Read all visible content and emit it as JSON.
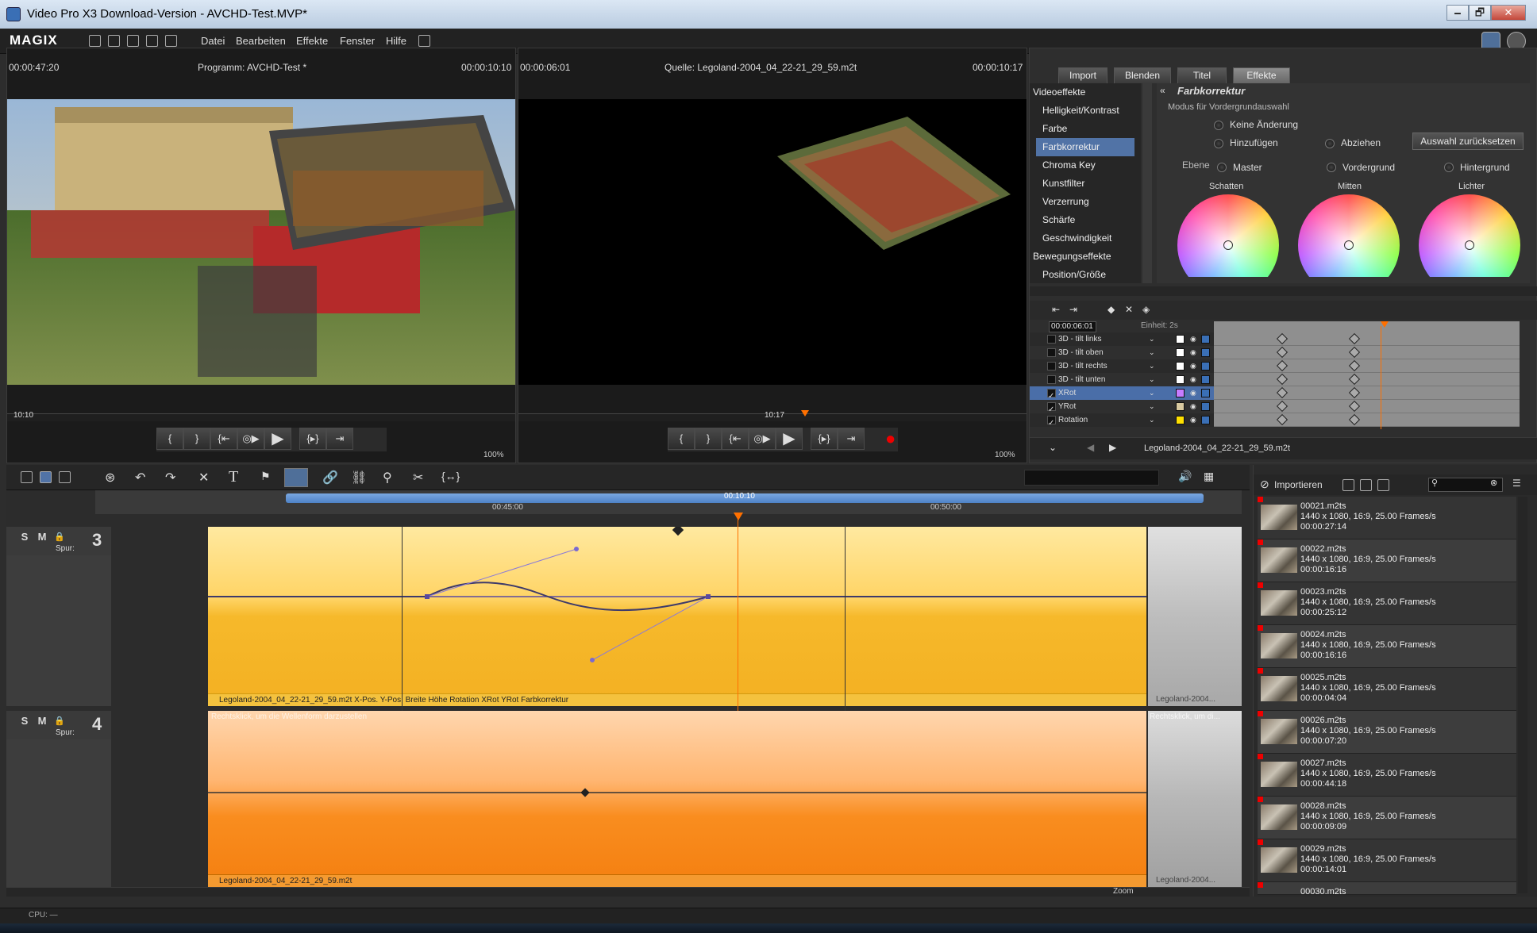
{
  "window": {
    "title": "Video Pro X3 Download-Version - AVCHD-Test.MVP*",
    "min": "🗕",
    "max": "🗗",
    "close": "✕"
  },
  "menu": {
    "logo": "MAGIX",
    "items": [
      "Datei",
      "Bearbeiten",
      "Effekte",
      "Fenster",
      "Hilfe"
    ]
  },
  "program_monitor": {
    "time_left": "00:00:47:20",
    "title": "Programm: AVCHD-Test *",
    "time_right": "00:00:10:10",
    "ruler_label": "10:10",
    "zoom": "100%"
  },
  "source_monitor": {
    "time_left": "00:00:06:01",
    "title": "Quelle: Legoland-2004_04_22-21_29_59.m2t",
    "time_right": "00:00:10:17",
    "ruler_label": "10:17",
    "zoom": "100%"
  },
  "transport": {
    "buttons": [
      "{",
      "}",
      "{⇤",
      "◎▶",
      "▶",
      "{▸}",
      "⇥"
    ],
    "record": "●"
  },
  "effects_panel": {
    "tabs": [
      "Import",
      "Blenden",
      "Titel",
      "Effekte"
    ],
    "active_tab": "Effekte",
    "categories": [
      {
        "label": "Videoeffekte",
        "items": [
          "Helligkeit/Kontrast",
          "Farbe",
          "Farbkorrektur",
          "Chroma Key",
          "Kunstfilter",
          "Verzerrung",
          "Schärfe",
          "Geschwindigkeit"
        ]
      },
      {
        "label": "Bewegungseffekte",
        "items": [
          "Position/Größe"
        ]
      }
    ],
    "selected_item": "Farbkorrektur",
    "heading": "Farbkorrektur",
    "mode_label": "Modus für Vordergrundauswahl",
    "radios": {
      "keine": "Keine Änderung",
      "hinzu": "Hinzufügen",
      "abziehen": "Abziehen"
    },
    "reset_button": "Auswahl zurücksetzen",
    "ebene_label": "Ebene",
    "ebene_options": [
      "Master",
      "Vordergrund",
      "Hintergrund"
    ],
    "wheels": [
      "Schatten",
      "Mitten",
      "Lichter"
    ]
  },
  "keyframes": {
    "time": "00:00:06:01",
    "unit": "Einheit: 2s",
    "rows": [
      {
        "name": "3D - tilt links",
        "checked": false,
        "color": "#ffffff"
      },
      {
        "name": "3D - tilt oben",
        "checked": false,
        "color": "#ffffff"
      },
      {
        "name": "3D - tilt rechts",
        "checked": false,
        "color": "#ffffff"
      },
      {
        "name": "3D - tilt unten",
        "checked": false,
        "color": "#ffffff"
      },
      {
        "name": "XRot",
        "checked": true,
        "color": "#c77cff"
      },
      {
        "name": "YRot",
        "checked": true,
        "color": "#d8c9a0"
      },
      {
        "name": "Rotation",
        "checked": true,
        "color": "#ffe000"
      }
    ],
    "selected_row": "XRot",
    "clip_label": "Legoland-2004_04_22-21_29_59.m2t"
  },
  "timeline": {
    "range_label": "00:10:10",
    "ticks": [
      "00:45:00",
      "00:50:00"
    ],
    "tracks": [
      {
        "number": "3",
        "spur": "Spur:",
        "clip_label": "Legoland-2004_04_22-21_29_59.m2t   X-Pos.  Y-Pos.  Breite  Höhe  Rotation  XRot  YRot  Farbkorrektur",
        "next_label": "Legoland-2004..."
      },
      {
        "number": "4",
        "spur": "Spur:",
        "hint": "Rechtsklick, um die Wellenform darzustellen",
        "hint_next": "Rechtsklick, um di...",
        "clip_label": "Legoland-2004_04_22-21_29_59.m2t",
        "next_label": "Legoland-2004..."
      }
    ],
    "zoom_label": "Zoom"
  },
  "media_pool": {
    "title": "Importieren",
    "items": [
      {
        "name": "00021.m2ts",
        "format": "1440 x 1080, 16:9, 25.00 Frames/s",
        "duration": "00:00:27:14"
      },
      {
        "name": "00022.m2ts",
        "format": "1440 x 1080, 16:9, 25.00 Frames/s",
        "duration": "00:00:16:16"
      },
      {
        "name": "00023.m2ts",
        "format": "1440 x 1080, 16:9, 25.00 Frames/s",
        "duration": "00:00:25:12"
      },
      {
        "name": "00024.m2ts",
        "format": "1440 x 1080, 16:9, 25.00 Frames/s",
        "duration": "00:00:16:16"
      },
      {
        "name": "00025.m2ts",
        "format": "1440 x 1080, 16:9, 25.00 Frames/s",
        "duration": "00:00:04:04"
      },
      {
        "name": "00026.m2ts",
        "format": "1440 x 1080, 16:9, 25.00 Frames/s",
        "duration": "00:00:07:20"
      },
      {
        "name": "00027.m2ts",
        "format": "1440 x 1080, 16:9, 25.00 Frames/s",
        "duration": "00:00:44:18"
      },
      {
        "name": "00028.m2ts",
        "format": "1440 x 1080, 16:9, 25.00 Frames/s",
        "duration": "00:00:09:09"
      },
      {
        "name": "00029.m2ts",
        "format": "1440 x 1080, 16:9, 25.00 Frames/s",
        "duration": "00:00:14:01"
      },
      {
        "name": "00030.m2ts",
        "format": "",
        "duration": ""
      }
    ]
  },
  "statusbar": {
    "cpu": "CPU: —"
  }
}
